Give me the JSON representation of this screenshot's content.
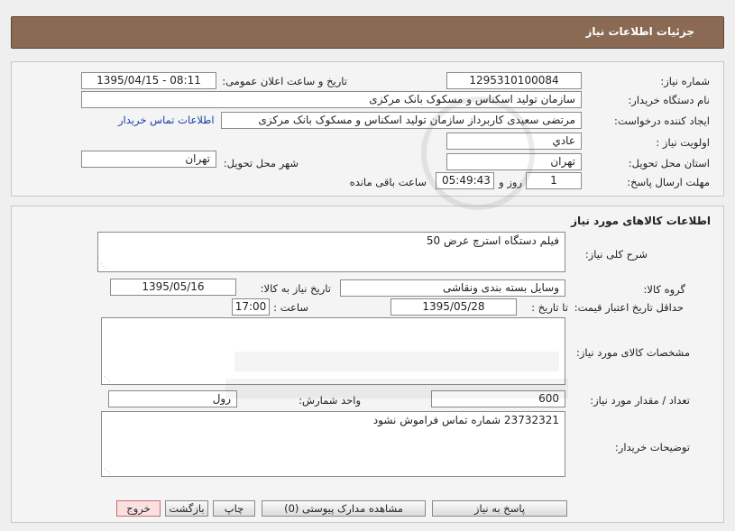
{
  "header": {
    "title": "جزئیات اطلاعات نیاز"
  },
  "need_info": {
    "need_number_label": "شماره نیاز:",
    "need_number": "1295310100084",
    "announce_label": "تاریخ و ساعت اعلان عمومی:",
    "announce_value": "1395/04/15 - 08:11",
    "buyer_org_label": "نام دستگاه خریدار:",
    "buyer_org": "سازمان تولید اسکناس و مسکوک بانک مرکزی",
    "requester_label": "ایجاد کننده درخواست:",
    "requester": "مرتضی سعیدی کاربرداز سازمان تولید اسکناس و مسکوک بانک مرکزی",
    "buyer_contact_link": "اطلاعات تماس خریدار",
    "priority_label": "اولویت نیاز :",
    "priority": "عادي",
    "province_label": "استان محل تحویل:",
    "province": "تهران",
    "city_label": "شهر محل تحویل:",
    "city": "تهران",
    "deadline_label": "مهلت ارسال پاسخ:",
    "days": "1",
    "days_unit": "روز و",
    "time_left": "05:49:43",
    "time_left_label": "ساعت باقی مانده"
  },
  "goods": {
    "section_title": "اطلاعات کالاهای مورد نیاز",
    "description_label": "شرح کلی نیاز:",
    "description": "فیلم دستگاه استرچ عرض 50",
    "group_label": "گروه کالا:",
    "group": "وسایل بسته بندی  ونقاشی",
    "need_date_label": "تاریخ نیاز به کالا:",
    "need_date": "1395/05/16",
    "validity_label": "حداقل تاریخ اعتبار قیمت:",
    "until_label": "تا تاریخ :",
    "validity_date": "1395/05/28",
    "time_label": "ساعت :",
    "validity_time": "17:00",
    "specs_label": "مشخصات کالای مورد نیاز:",
    "specs": "",
    "qty_label": "تعداد / مقدار مورد نیاز:",
    "qty": "600",
    "unit_label": "واحد شمارش:",
    "unit": "رول",
    "buyer_notes_label": "توضیحات خریدار:",
    "buyer_notes": "23732321  شماره تماس فراموش نشود"
  },
  "buttons": {
    "reply": "پاسخ به نیاز",
    "attachments": "مشاهده مدارک پیوستی (0)",
    "print": "چاپ",
    "back": "بازگشت",
    "exit": "خروج"
  },
  "colors": {
    "header_bg": "#8a6a52",
    "link": "#1a3fa8",
    "exit_bg": "#fbe0e0"
  }
}
